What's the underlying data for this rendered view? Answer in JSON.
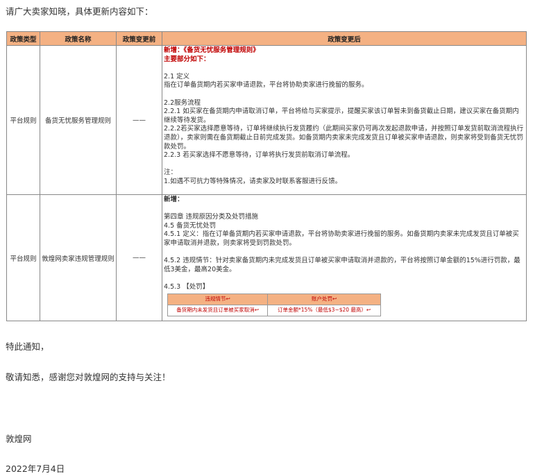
{
  "intro": "请广大卖家知晓，具体更新内容如下：",
  "table": {
    "headers": [
      "政策类型",
      "政策名称",
      "政策变更前",
      "政策变更后"
    ],
    "row1": {
      "type": "平台规则",
      "name": "备货无忧服务管理规则",
      "before": "——",
      "after": {
        "l1": "新增：《备货无忧服务管理规则》",
        "l2": "主要部分如下：",
        "l3": "2.1 定义",
        "l4": "指在订单备货期内若买家申请退款，平台将协助卖家进行挽留的服务。",
        "l5": "2.2服务流程",
        "l6": "2.2.1 如买家在备货期内申请取消订单，平台将给与买家提示，提醒买家该订单暂未到备货截止日期，建议买家在备货期内继续等待发货。",
        "l7": "2.2.2若买家选择愿意等待，订单将继续执行发货履约（此期间买家仍可再次发起退款申请，并按照订单发货前取消流程执行退款），卖家则需在备货期截止日前完成发货。如备货期内卖家未完成发货且订单被买家申请退款，则卖家将受到备货无忧罚款处罚。",
        "l8": "2.2.3 若买家选择不愿意等待，订单将执行发货前取消订单流程。",
        "l9": "注：",
        "l10": "1.如遇不可抗力等特殊情况，请卖家及时联系客服进行反馈。"
      }
    },
    "row2": {
      "type": "平台规则",
      "name": "敦煌网卖家违规管理规则",
      "before": "——",
      "after": {
        "l1": "新增：",
        "l2": "第四章 违规原因分类及处罚措施",
        "l3": "4.5 备货无忧处罚",
        "l4": "4.5.1 定义：指在订单备货期内若买家申请退款，平台将协助卖家进行挽留的服务。如备货期内卖家未完成发货且订单被买家申请取消并退款，则卖家将受到罚款处罚。",
        "l5": "4.5.2 违规情节：针对卖家备货期内未完成发货且订单被买家申请取消并退款的，平台将按照订单金额的15%进行罚款，最低3美金，最高20美金。",
        "l6": "4.5.3 【处罚】",
        "mini": {
          "h1": "违规情节↩",
          "h2": "账户处罚↩",
          "c1": "备货期内未发货且订单被买家取消↩",
          "c2": "订单金额*15%（最低$3~$20 最高）↩"
        }
      }
    }
  },
  "closing": "特此通知，",
  "thanks": "敬请知悉，感谢您对敦煌网的支持与关注！",
  "signature": "敦煌网",
  "date": "2022年7月4日"
}
